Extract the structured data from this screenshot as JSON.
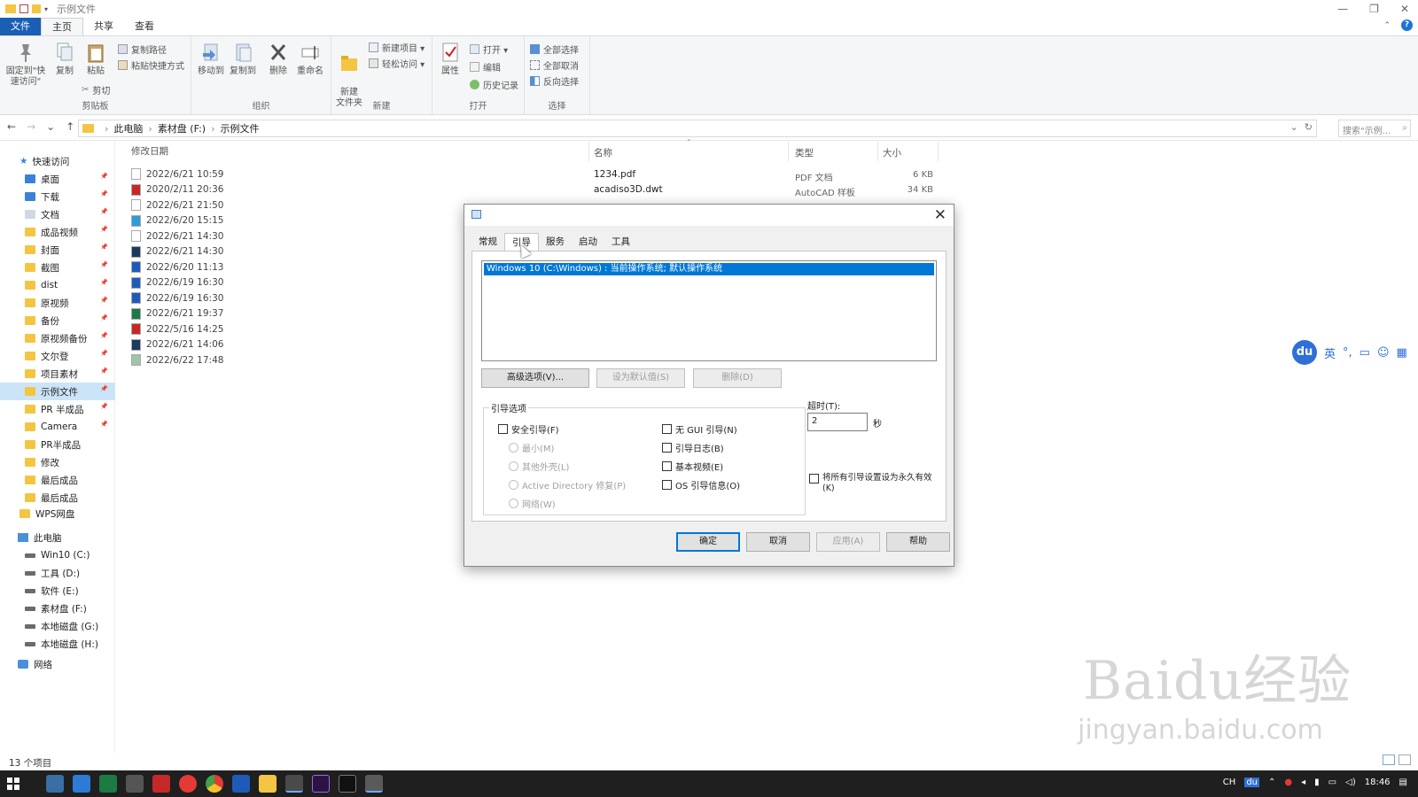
{
  "window": {
    "title": "示例文件",
    "controls": [
      "—",
      "❐",
      "✕"
    ]
  },
  "ribbon_tabs": [
    "文件",
    "主页",
    "共享",
    "查看"
  ],
  "ribbon": {
    "clipboard": {
      "label": "剪贴板",
      "pin": "固定到\"快速访问\"",
      "copy": "复制",
      "paste": "粘贴",
      "copy_path": "复制路径",
      "paste_shortcut": "粘贴快捷方式",
      "cut": "剪切"
    },
    "organize": {
      "label": "组织",
      "move_to": "移动到",
      "copy_to": "复制到",
      "delete": "删除",
      "rename": "重命名"
    },
    "new": {
      "label": "新建",
      "new_folder": "新建\n文件夹",
      "new_item": "新建项目 ▾",
      "easy_access": "轻松访问 ▾"
    },
    "open": {
      "label": "打开",
      "properties": "属性",
      "open": "打开 ▾",
      "edit": "编辑",
      "history": "历史记录"
    },
    "select": {
      "label": "选择",
      "select_all": "全部选择",
      "select_none": "全部取消",
      "invert": "反向选择"
    }
  },
  "address": {
    "path": [
      "此电脑",
      "素材盘 (F:)",
      "示例文件"
    ],
    "search_placeholder": "搜索\"示例...",
    "nav": [
      "←",
      "→",
      "⌄",
      "↑"
    ]
  },
  "sidebar": {
    "quick_access": "快速访问",
    "items": [
      "桌面",
      "下载",
      "文档",
      "成品视频",
      "封面",
      "截图",
      "dist",
      "原视频",
      "备份",
      "原视频备份",
      "文尔登",
      "项目素材",
      "示例文件",
      "PR 半成品",
      "Camera",
      "PR半成品",
      "修改",
      "最后成品",
      "最后成品"
    ],
    "wps": "WPS网盘",
    "this_pc": "此电脑",
    "drives": [
      "Win10 (C:)",
      "工具 (D:)",
      "软件 (E:)",
      "素材盘 (F:)",
      "本地磁盘 (G:)",
      "本地磁盘 (H:)"
    ],
    "network": "网络"
  },
  "columns": {
    "modified": "修改日期",
    "name": "名称",
    "type": "类型",
    "size": "大小"
  },
  "dates": [
    "2022/6/21 10:59",
    "2020/2/11 20:36",
    "2022/6/21 21:50",
    "2022/6/20 15:15",
    "2022/6/21 14:30",
    "2022/6/21 14:30",
    "2022/6/20 11:13",
    "2022/6/19 16:30",
    "2022/6/19 16:30",
    "2022/6/21 19:37",
    "2022/5/16 14:25",
    "2022/6/21 14:06",
    "2022/6/22 17:48"
  ],
  "files": [
    {
      "name": "1234.pdf",
      "type": "PDF 文档",
      "size": "6 KB"
    },
    {
      "name": "acadiso3D.dwt",
      "type": "AutoCAD 样板",
      "size": "34 KB"
    }
  ],
  "status": {
    "count": "13 个项目"
  },
  "dialog": {
    "tabs": [
      "常规",
      "引导",
      "服务",
      "启动",
      "工具"
    ],
    "boot_entry": "Windows 10 (C:\\Windows) : 当前操作系统; 默认操作系统",
    "advanced": "高级选项(V)...",
    "set_default": "设为默认值(S)",
    "delete": "删除(D)",
    "boot_options_label": "引导选项",
    "safe_boot": "安全引导(F)",
    "minimal": "最小(M)",
    "alt_shell": "其他外壳(L)",
    "ad_repair": "Active Directory 修复(P)",
    "network": "网络(W)",
    "no_gui": "无 GUI 引导(N)",
    "boot_log": "引导日志(B)",
    "base_video": "基本视频(E)",
    "os_info": "OS 引导信息(O)",
    "timeout_label": "超时(T):",
    "timeout_value": "2",
    "timeout_unit": "秒",
    "permanent": "将所有引导设置设为永久有效(K)",
    "ok": "确定",
    "cancel": "取消",
    "apply": "应用(A)",
    "help": "帮助"
  },
  "baidu_float": {
    "logo": "du",
    "lang": "英"
  },
  "watermark": {
    "big": "Baidu经验",
    "small": "jingyan.baidu.com"
  },
  "tray": {
    "ime": "CH",
    "time": "18:46"
  }
}
